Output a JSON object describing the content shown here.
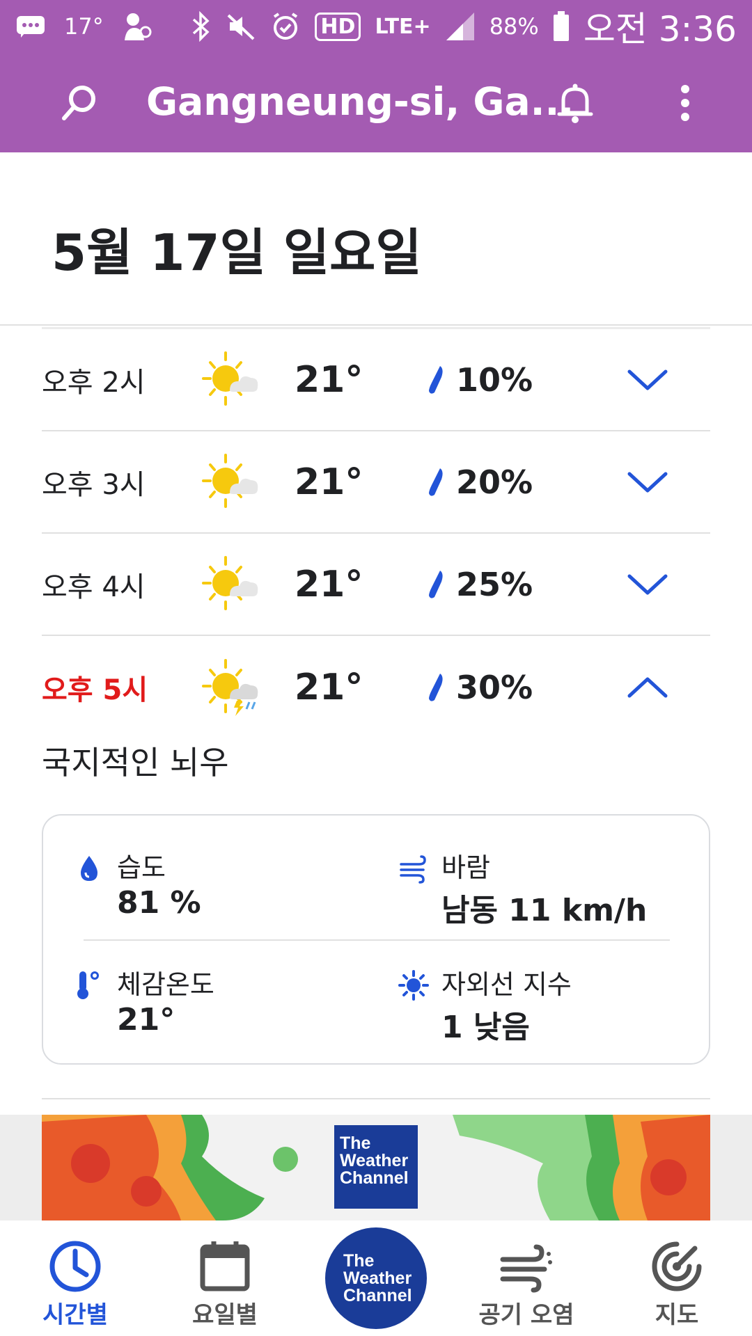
{
  "status_bar": {
    "temperature": "17°",
    "hd": "HD",
    "network": "LTE+",
    "battery": "88%",
    "time": "오전 3:36"
  },
  "app_bar": {
    "title": "Gangneung-si, Ga..."
  },
  "date_header": "5월 17일 일요일",
  "hourly": [
    {
      "time": "오후 2시",
      "temp": "21°",
      "precip": "10%",
      "icon": "partly-sunny-icon",
      "expanded": false
    },
    {
      "time": "오후 3시",
      "temp": "21°",
      "precip": "20%",
      "icon": "partly-sunny-icon",
      "expanded": false
    },
    {
      "time": "오후 4시",
      "temp": "21°",
      "precip": "25%",
      "icon": "partly-sunny-icon",
      "expanded": false
    },
    {
      "time": "오후 5시",
      "temp": "21°",
      "precip": "30%",
      "icon": "partly-sunny-thunder-icon",
      "expanded": true
    }
  ],
  "expanded": {
    "condition": "국지적인 뇌우",
    "humidity": {
      "label": "습도",
      "value": "81 %"
    },
    "wind": {
      "label": "바람",
      "value": "남동 11 km/h"
    },
    "feels_like": {
      "label": "체감온도",
      "value": "21°"
    },
    "uv": {
      "label": "자외선 지수",
      "value": "1 낮음"
    }
  },
  "ad": {
    "logo": [
      "The",
      "Weather",
      "Channel"
    ]
  },
  "bottom_nav": {
    "hourly": "시간별",
    "daily": "요일별",
    "center_logo": [
      "The",
      "Weather",
      "Channel"
    ],
    "air": "공기 오염",
    "map": "지도"
  },
  "colors": {
    "header_purple": "#a45bb2",
    "accent_blue": "#2254d8",
    "active_red": "#e11b1b",
    "twc_blue": "#1a3c98"
  }
}
